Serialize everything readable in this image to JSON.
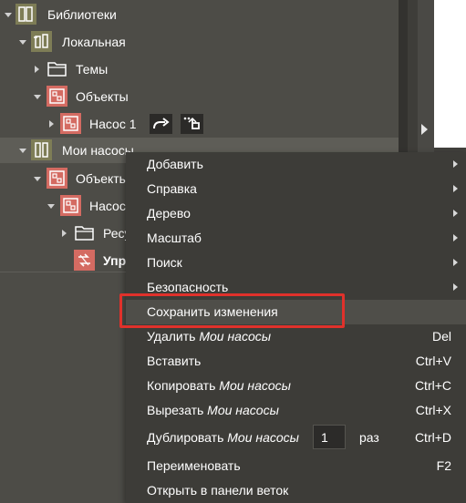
{
  "tree": {
    "items": [
      {
        "label": "Библиотеки",
        "icon": "library-icon"
      },
      {
        "label": "Локальная",
        "icon": "library-icon"
      },
      {
        "label": "Темы",
        "icon": "folder-icon"
      },
      {
        "label": "Объекты",
        "icon": "object-icon"
      },
      {
        "label": "Насос 1",
        "icon": "object-icon"
      },
      {
        "label": "Мои насосы",
        "icon": "library-icon"
      },
      {
        "label": "Объекты",
        "icon": "object-icon"
      },
      {
        "label": "Насос",
        "icon": "object-icon"
      },
      {
        "label": "Ресу",
        "icon": "folder-icon"
      },
      {
        "label": "Упр",
        "icon": "control-icon"
      }
    ],
    "row_actions": [
      "go-to-icon",
      "insert-icon"
    ]
  },
  "context_menu": {
    "items": [
      {
        "label": "Добавить",
        "submenu": true
      },
      {
        "label": "Справка",
        "submenu": true
      },
      {
        "label": "Дерево",
        "submenu": true
      },
      {
        "label": "Масштаб",
        "submenu": true
      },
      {
        "label": "Поиск",
        "submenu": true
      },
      {
        "label": "Безопасность",
        "submenu": true
      },
      {
        "label": "Сохранить изменения",
        "highlighted": true
      },
      {
        "label": "Удалить",
        "object": "Мои насосы",
        "shortcut": "Del"
      },
      {
        "label": "Вставить",
        "shortcut": "Ctrl+V"
      },
      {
        "label": "Копировать",
        "object": "Мои насосы",
        "shortcut": "Ctrl+C"
      },
      {
        "label": "Вырезать",
        "object": "Мои насосы",
        "shortcut": "Ctrl+X"
      },
      {
        "label": "Дублировать",
        "object": "Мои насосы",
        "shortcut": "Ctrl+D",
        "count": "1",
        "count_unit": "раз"
      },
      {
        "label": "Переименовать",
        "shortcut": "F2"
      },
      {
        "label": "Открыть в панели веток"
      }
    ]
  },
  "colors": {
    "panel_bg": "#4d4c47",
    "menu_bg": "#3d3c38",
    "menu_highlight": "#4f4e49",
    "library_icon": "#7e7d56",
    "object_icon": "#d46b62",
    "highlight_outline": "#e0312b"
  }
}
